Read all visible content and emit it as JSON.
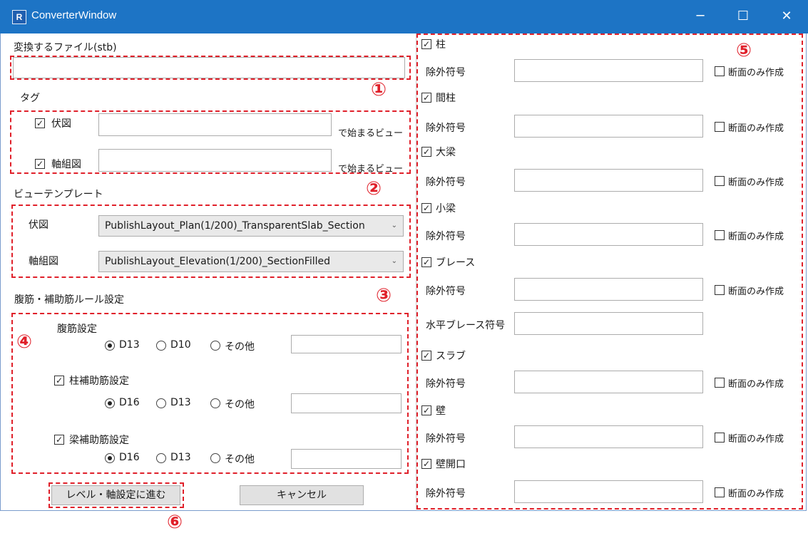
{
  "window": {
    "title": "ConverterWindow",
    "icon_letter": "R",
    "minimize": "─",
    "maximize": "☐",
    "close": "✕"
  },
  "left": {
    "file_label": "変換するファイル(stb)",
    "file_value": "",
    "tag_label": "タグ",
    "tags": [
      {
        "label": "伏図",
        "checked": true,
        "value": "",
        "suffix": "で始まるビュー"
      },
      {
        "label": "軸組図",
        "checked": true,
        "value": "",
        "suffix": "で始まるビュー"
      }
    ],
    "template_label": "ビューテンプレート",
    "templates": [
      {
        "label": "伏図",
        "value": "PublishLayout_Plan(1/200)_TransparentSlab_Section"
      },
      {
        "label": "軸組図",
        "value": "PublishLayout_Elevation(1/200)_SectionFilled"
      }
    ],
    "rebar_label": "腹筋・補助筋ルール設定",
    "rebar_groups": [
      {
        "label": "腹筋設定",
        "checkbox": false,
        "options": [
          "D13",
          "D10",
          "その他"
        ],
        "selected": 0
      },
      {
        "label": "柱補助筋設定",
        "checkbox": true,
        "options": [
          "D16",
          "D13",
          "その他"
        ],
        "selected": 0
      },
      {
        "label": "梁補助筋設定",
        "checkbox": true,
        "options": [
          "D16",
          "D13",
          "その他"
        ],
        "selected": 0
      }
    ],
    "next_button": "レベル・軸設定に進む",
    "cancel_button": "キャンセル"
  },
  "right": {
    "exclude_label": "除外符号",
    "section_only_label": "断面のみ作成",
    "elements": [
      {
        "label": "柱",
        "checked": true
      },
      {
        "label": "間柱",
        "checked": true
      },
      {
        "label": "大梁",
        "checked": true
      },
      {
        "label": "小梁",
        "checked": true
      },
      {
        "label": "ブレース",
        "checked": true
      },
      {
        "label": "スラブ",
        "checked": true
      },
      {
        "label": "壁",
        "checked": true
      },
      {
        "label": "壁開口",
        "checked": true
      }
    ],
    "horizontal_brace_label": "水平ブレース符号"
  },
  "markers": [
    "①",
    "②",
    "③",
    "④",
    "⑤",
    "⑥"
  ],
  "colors": {
    "titlebar": "#1d74c5",
    "annotation": "#e0202a"
  }
}
